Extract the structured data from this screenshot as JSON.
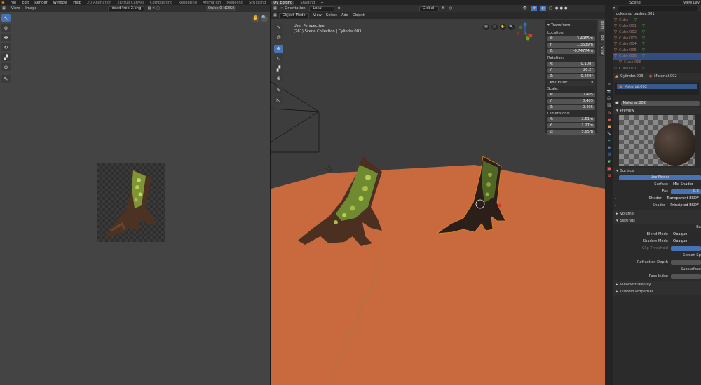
{
  "menu": {
    "items": [
      "File",
      "Edit",
      "Render",
      "Window",
      "Help"
    ],
    "workspaces": [
      "2D Animation",
      "2D Full Canvas",
      "Compositing",
      "Rendering",
      "Animation",
      "Modeling",
      "Sculpting",
      "UV Editing",
      "Shading"
    ],
    "active_workspace": "UV Editing",
    "scene": "Scene",
    "view_layer": "View Lay"
  },
  "uv": {
    "menu": [
      "View",
      "Image"
    ],
    "image_name": "dead-tree-2.png",
    "quick_noise": "Quick 0-NOISE"
  },
  "vp": {
    "mode": "Object Mode",
    "menu": [
      "View",
      "Select",
      "Add",
      "Object"
    ],
    "orientation_label": "Orientation:",
    "orientation": "Local",
    "transform_space": "Global",
    "perspective": "User Perspective",
    "collection_line": "(261) Scene Collection | Cylinder.003"
  },
  "npanel": {
    "title": "Transform",
    "tabs": [
      "Item",
      "Tool",
      "View"
    ],
    "location_label": "Location:",
    "location": [
      {
        "a": "X:",
        "v": "3.4965m"
      },
      {
        "a": "Y:",
        "v": "1.3639m"
      },
      {
        "a": "Z:",
        "v": "-0.74774m"
      }
    ],
    "rotation_label": "Rotation:",
    "rotation": [
      {
        "a": "X:",
        "v": "0.108°"
      },
      {
        "a": "Y:",
        "v": "26.2°"
      },
      {
        "a": "Z:",
        "v": "0.249°"
      }
    ],
    "euler": "XYZ Euler",
    "scale_label": "Scale:",
    "scale": [
      {
        "a": "X:",
        "v": "0.405"
      },
      {
        "a": "Y:",
        "v": "0.405"
      },
      {
        "a": "Z:",
        "v": "0.405"
      }
    ],
    "dimensions_label": "Dimensions:",
    "dimensions": [
      {
        "a": "X:",
        "v": "2.51m"
      },
      {
        "a": "Y:",
        "v": "1.27m"
      },
      {
        "a": "Z:",
        "v": "5.65m"
      }
    ]
  },
  "outliner": {
    "search": "",
    "rows": [
      {
        "t": "rocks and bushes.001",
        "d": 0,
        "sel": false
      },
      {
        "t": "Cube",
        "d": 1,
        "sel": false
      },
      {
        "t": "Cube.001",
        "d": 1,
        "sel": false
      },
      {
        "t": "Cube.002",
        "d": 1,
        "sel": false
      },
      {
        "t": "Cube.003",
        "d": 1,
        "sel": false
      },
      {
        "t": "Cube.004",
        "d": 1,
        "sel": false
      },
      {
        "t": "Cube.005",
        "d": 1,
        "sel": false
      },
      {
        "t": "Cube.006",
        "d": 1,
        "sel": true
      },
      {
        "t": "Cube.006",
        "d": 2,
        "sel": false
      },
      {
        "t": "Cube.007",
        "d": 1,
        "sel": false
      }
    ]
  },
  "props": {
    "object": "Cylinder.003",
    "material": "Material.002",
    "slot": "Material.002",
    "mat_name": "Material.002",
    "preview": "Preview",
    "surface_section": "Surface",
    "use_nodes": "Use Nodes",
    "surface_label": "Surface",
    "surface_value": "Mix Shader",
    "fac_label": "Fac",
    "fac_value": "0.5",
    "shader_label": "Shader",
    "shader1": "Transparent BSDF",
    "shader2": "Principled BSDF",
    "volume": "Volume",
    "settings": "Settings",
    "backface": "Ba",
    "blend_label": "Blend Mode",
    "blend_value": "Opaque",
    "shadow_label": "Shadow Mode",
    "shadow_value": "Opaque",
    "clip_label": "Clip Threshold",
    "screen_space": "Screen Sp",
    "refraction_label": "Refraction Depth",
    "subsurface": "Subsurface",
    "pass_label": "Pass Index",
    "viewport_display": "Viewport Display",
    "custom_props": "Custom Properties"
  }
}
